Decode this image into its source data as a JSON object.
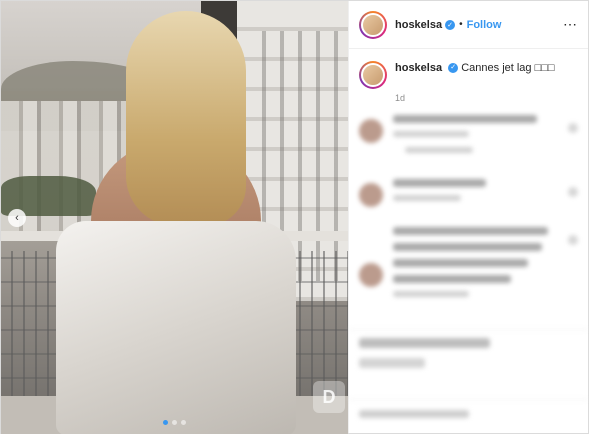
{
  "post": {
    "username": "hoskelsa",
    "verified_icon": "verified-badge-icon",
    "separator": "•",
    "follow_label": "Follow",
    "more_label": "⋯",
    "caption_text": "Cannes jet lag",
    "caption_emojis": "□□□",
    "time_ago": "1d",
    "carousel": {
      "prev_icon": "chevron-left-icon",
      "dot_count": 3,
      "active_dot_index": 0
    }
  }
}
